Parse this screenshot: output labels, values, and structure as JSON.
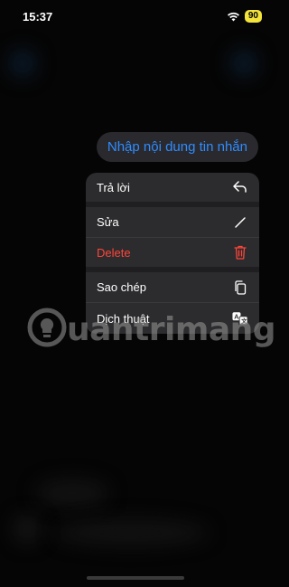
{
  "status_bar": {
    "time": "15:37",
    "battery": "90",
    "wifi_icon": "wifi-icon"
  },
  "message": {
    "text": "Nhập nội dung tin nhắn"
  },
  "context_menu": {
    "items": [
      {
        "label": "Trả lời",
        "icon": "reply-icon"
      },
      {
        "label": "Sửa",
        "icon": "pencil-icon"
      },
      {
        "label": "Delete",
        "icon": "trash-icon",
        "color": "#ff453a"
      },
      {
        "label": "Sao chép",
        "icon": "copy-icon"
      },
      {
        "label": "Dịch thuật",
        "icon": "translate-icon"
      }
    ]
  },
  "watermark": {
    "text": "uantrimang"
  },
  "colors": {
    "accent": "#2f8cff",
    "danger": "#ff453a",
    "menu_bg": "#2c2c2e"
  }
}
